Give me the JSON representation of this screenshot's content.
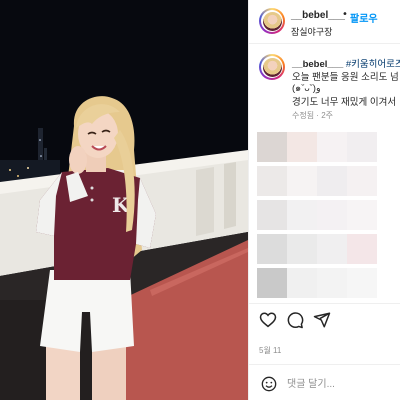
{
  "post": {
    "username": "__bebel___",
    "follow_label": "팔로우",
    "dot": "•",
    "location": "잠실야구장"
  },
  "caption": {
    "username": "__bebel___",
    "hashtag": "#키움히어로즈",
    "line1": "오늘 팬분들 응원 소리도 넘",
    "line2": "(๑ˇᴗˇ)و",
    "line3": "경기도 너무 재밌게 이겨서",
    "meta": "수정됨 · 2주"
  },
  "actions": {
    "like": "heart-icon",
    "comment": "comment-icon",
    "share": "share-icon"
  },
  "date": "5월 11",
  "comment_box": {
    "placeholder": "댓글 달기..."
  },
  "colors": {
    "follow_blue": "#0095f6",
    "jersey": "#6b2233",
    "track": "#b8564f"
  }
}
